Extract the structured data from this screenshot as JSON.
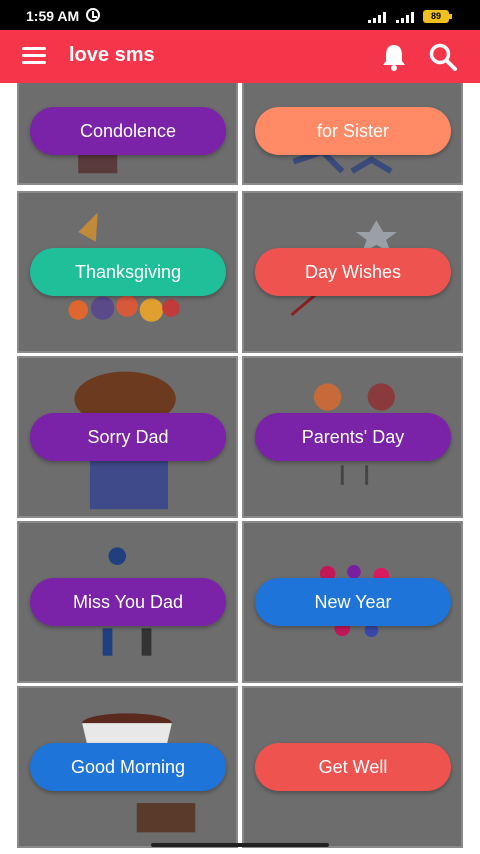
{
  "status_bar": {
    "time": "1:59 AM",
    "battery": "89"
  },
  "app_bar": {
    "title": "love sms",
    "icons": [
      "menu-icon",
      "bell-icon",
      "search-icon"
    ]
  },
  "categories": [
    {
      "label": "Condolence",
      "color": "#7a22a8"
    },
    {
      "label": "for Sister",
      "color": "#ff8a65"
    },
    {
      "label": "Thanksgiving",
      "color": "#1fbf9a"
    },
    {
      "label": "Day Wishes",
      "color": "#ef5350"
    },
    {
      "label": "Sorry Dad",
      "color": "#7a22a8"
    },
    {
      "label": "Parents' Day",
      "color": "#7a22a8"
    },
    {
      "label": "Miss You Dad",
      "color": "#7a22a8"
    },
    {
      "label": "New Year",
      "color": "#1e74d8"
    },
    {
      "label": "Good Morning",
      "color": "#1e74d8"
    },
    {
      "label": "Get Well",
      "color": "#ef5350"
    }
  ]
}
